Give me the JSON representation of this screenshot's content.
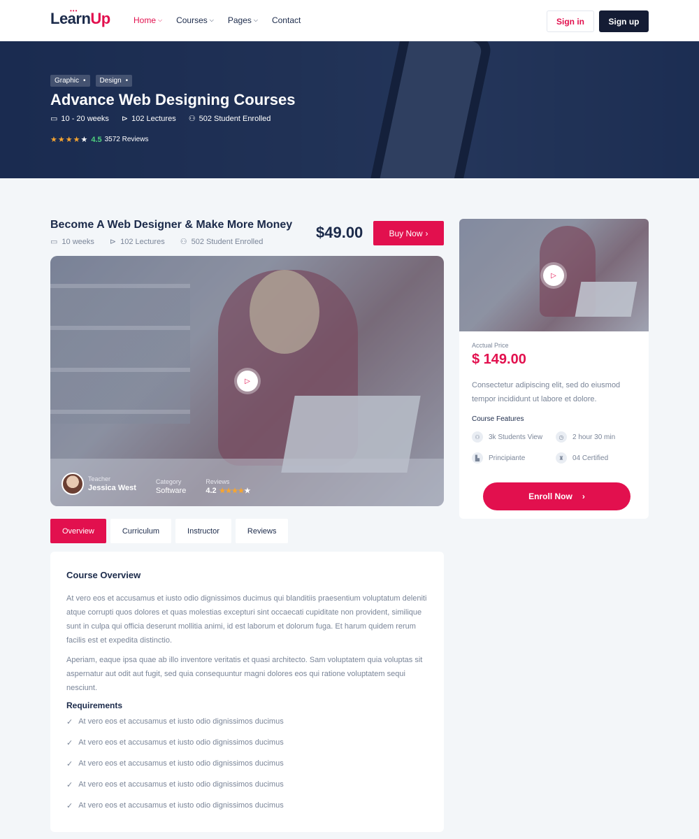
{
  "brand": {
    "name_part1": "Learn",
    "name_part2": "Up"
  },
  "nav": [
    {
      "label": "Home",
      "dropdown": true,
      "active": true
    },
    {
      "label": "Courses",
      "dropdown": true,
      "active": false
    },
    {
      "label": "Pages",
      "dropdown": true,
      "active": false
    },
    {
      "label": "Contact",
      "dropdown": false,
      "active": false
    }
  ],
  "header": {
    "signin_label": "Sign in",
    "signup_label": "Sign up"
  },
  "hero": {
    "tags": [
      "Graphic",
      "Design"
    ],
    "title": "Advance Web Designing Courses",
    "duration": "10 - 20 weeks",
    "lectures": "102 Lectures",
    "enrolled": "502 Student Enrolled",
    "rating": "4.5",
    "reviews": "3572 Reviews",
    "stars_filled": 4
  },
  "course": {
    "title": "Become A Web Designer & Make More Money",
    "duration": "10 weeks",
    "lectures": "102 Lectures",
    "enrolled": "502 Student Enrolled",
    "price": "$49.00",
    "buy_label": "Buy Now"
  },
  "video": {
    "teacher_label": "Teacher",
    "teacher_name": "Jessica West",
    "category_label": "Category",
    "category_value": "Software",
    "reviews_label": "Reviews",
    "reviews_value": "4.2",
    "stars_filled": 4
  },
  "tabs": [
    {
      "label": "Overview",
      "active": true
    },
    {
      "label": "Curriculum",
      "active": false
    },
    {
      "label": "Instructor",
      "active": false
    },
    {
      "label": "Reviews",
      "active": false
    }
  ],
  "overview": {
    "title": "Course Overview",
    "paragraph1": "At vero eos et accusamus et iusto odio dignissimos ducimus qui blanditiis praesentium voluptatum deleniti atque corrupti quos dolores et quas molestias excepturi sint occaecati cupiditate non provident, similique sunt in culpa qui officia deserunt mollitia animi, id est laborum et dolorum fuga. Et harum quidem rerum facilis est et expedita distinctio.",
    "paragraph2": "Aperiam, eaque ipsa quae ab illo inventore veritatis et quasi architecto. Sam voluptatem quia voluptas sit aspernatur aut odit aut fugit, sed quia consequuntur magni dolores eos qui ratione voluptatem sequi nesciunt.",
    "requirements_title": "Requirements",
    "requirements": [
      "At vero eos et accusamus et iusto odio dignissimos ducimus",
      "At vero eos et accusamus et iusto odio dignissimos ducimus",
      "At vero eos et accusamus et iusto odio dignissimos ducimus",
      "At vero eos et accusamus et iusto odio dignissimos ducimus",
      "At vero eos et accusamus et iusto odio dignissimos ducimus"
    ]
  },
  "sidebar": {
    "price_label": "Acctual Price",
    "price_value": "$ 149.00",
    "description": "Consectetur adipiscing elit, sed do eiusmod tempor incididunt ut labore et dolore.",
    "features_title": "Course Features",
    "features": [
      {
        "icon": "user-icon",
        "label": "3k Students View"
      },
      {
        "icon": "clock-icon",
        "label": "2 hour 30 min"
      },
      {
        "icon": "level-icon",
        "label": "Principiante"
      },
      {
        "icon": "certificate-icon",
        "label": "04 Certified"
      }
    ],
    "enroll_label": "Enroll Now"
  },
  "colors": {
    "accent": "#e2104e",
    "dark": "#141c34",
    "star": "#f7a531",
    "rating_green": "#4fd17f"
  }
}
